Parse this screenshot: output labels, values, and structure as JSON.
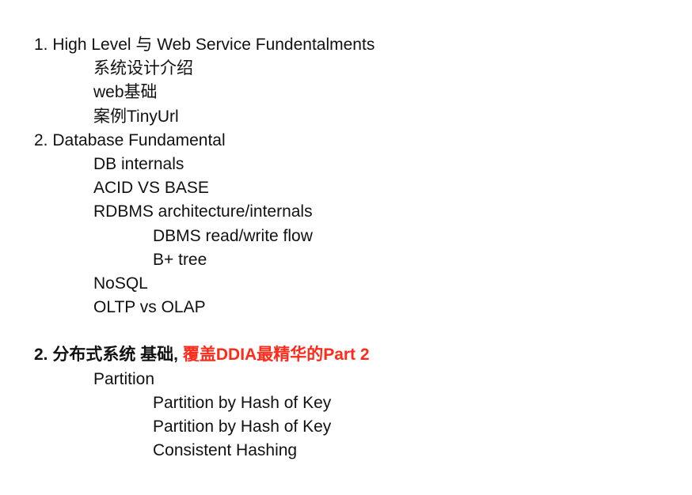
{
  "doc": {
    "section1": {
      "title": "1. High Level 与 Web Service Fundentalments",
      "items": [
        "系统设计介绍",
        "web基础",
        "案例TinyUrl"
      ]
    },
    "section2": {
      "title": "2. Database Fundamental",
      "items": {
        "db_internals": "DB internals",
        "acid_vs_base": "ACID VS BASE",
        "rdbms": "RDBMS architecture/internals",
        "rdbms_sub": [
          "DBMS read/write flow",
          "B+ tree"
        ],
        "nosql": "NoSQL",
        "oltp": "OLTP vs OLAP"
      }
    },
    "section3": {
      "title_black": "2. 分布式系统 基础, ",
      "title_red": "覆盖DDIA最精华的Part 2",
      "item": "Partition",
      "sub_items": [
        "Partition by Hash of Key",
        "Partition by Hash of Key",
        "Consistent Hashing"
      ]
    }
  },
  "colors": {
    "text": "#111111",
    "accent_red": "#ff2a1a"
  }
}
